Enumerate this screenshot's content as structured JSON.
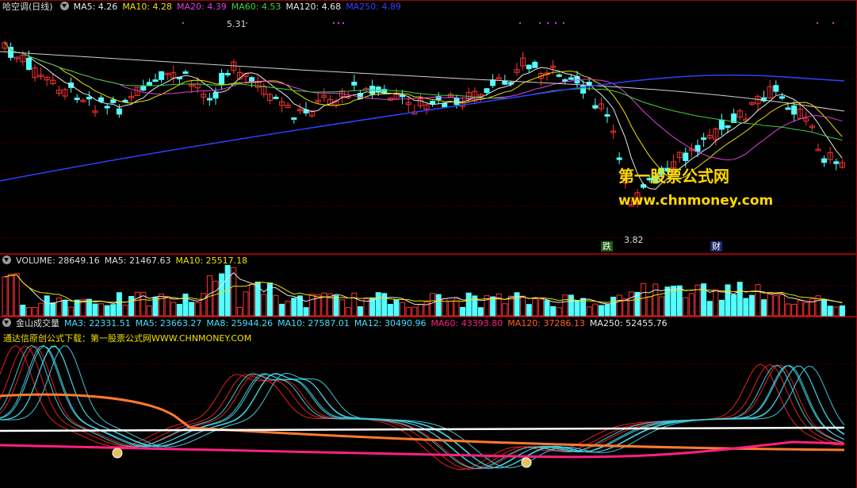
{
  "main_panel": {
    "title": "哈空调(日线)",
    "indicators": [
      {
        "label": "MA5: 4.26",
        "color": "#e8e8e8"
      },
      {
        "label": "MA10: 4.28",
        "color": "#f0e000"
      },
      {
        "label": "MA20: 4.39",
        "color": "#e040e0"
      },
      {
        "label": "MA60: 4.53",
        "color": "#40d040"
      },
      {
        "label": "MA120: 4.68",
        "color": "#d0d0d0"
      },
      {
        "label": "MA250: 4.89",
        "color": "#3040ff"
      }
    ],
    "high_label": "5.31",
    "low_label": "3.82",
    "tag_die": "跌",
    "tag_cai": "财",
    "watermark_cn": "第一股票公式网",
    "watermark_url": "www.chnmoney.com",
    "price_range": [
      3.6,
      5.45
    ]
  },
  "volume_panel": {
    "title": "VOLUME: 28649.16",
    "ma5": "MA5: 21467.63",
    "ma10": "MA10: 25517.18"
  },
  "indicator_panel": {
    "title": "金山成交量",
    "values": [
      {
        "label": "MA3: 22331.51",
        "color": "#40e0ff"
      },
      {
        "label": "MA5: 23663.27",
        "color": "#40e0ff"
      },
      {
        "label": "MA8: 25944.26",
        "color": "#40e0ff"
      },
      {
        "label": "MA10: 27587.01",
        "color": "#40e0ff"
      },
      {
        "label": "MA12: 30490.96",
        "color": "#40e0ff"
      },
      {
        "label": "MA60: 43393.80",
        "color": "#ff2080"
      },
      {
        "label": "MA120: 37286.13",
        "color": "#ff6020"
      },
      {
        "label": "MA250: 52455.76",
        "color": "#e8e8e8"
      }
    ],
    "note": "通达信原创公式下载：第一股票公式网WWW.CHNMONEY.COM"
  },
  "colors": {
    "up": "#ff3232",
    "down": "#54ffff",
    "grid": "#7a0000",
    "bg": "#000000"
  }
}
